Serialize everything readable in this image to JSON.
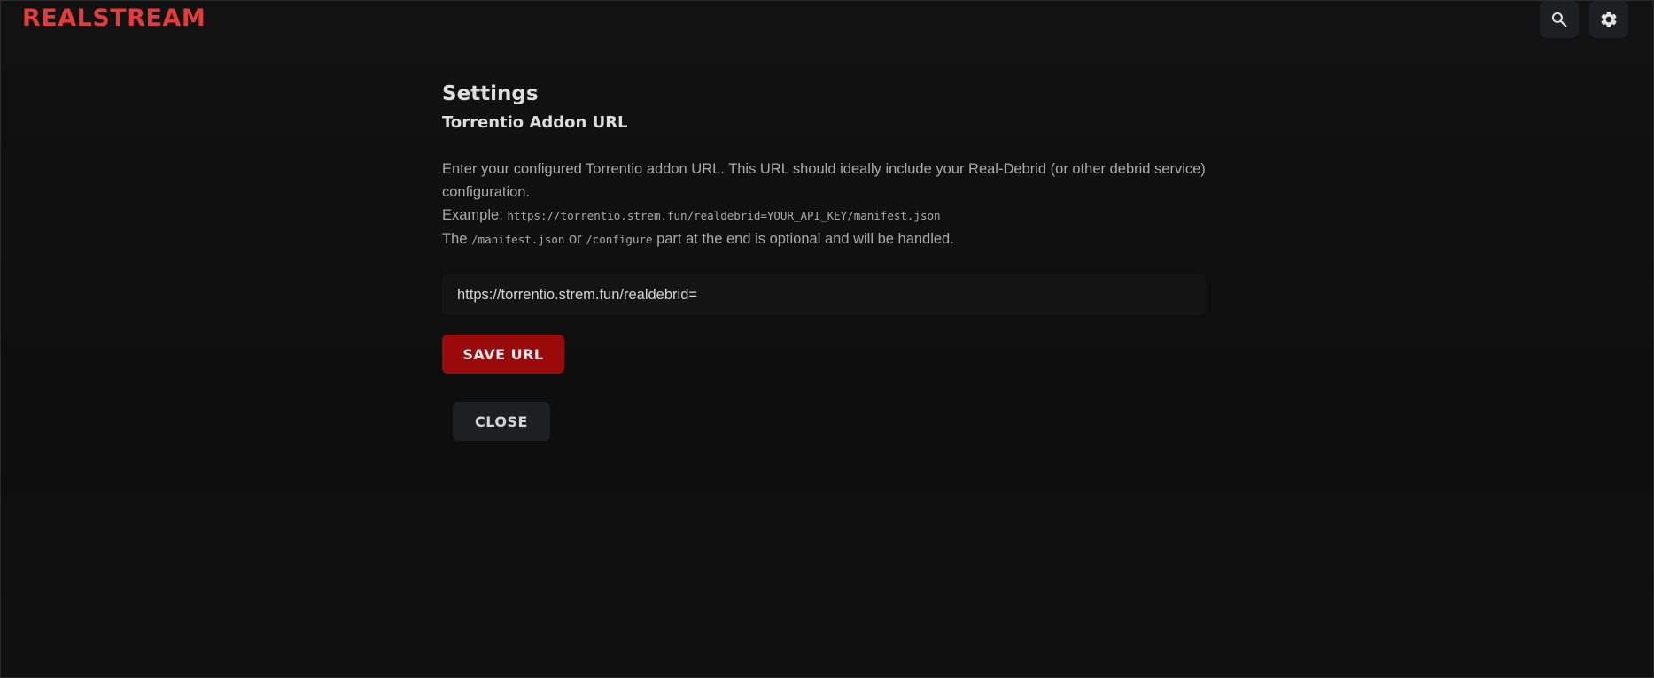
{
  "header": {
    "logo": "REALSTREAM",
    "search_icon": "search-icon",
    "settings_icon": "gear-icon"
  },
  "settings": {
    "title": "Settings",
    "section_title": "Torrentio Addon URL",
    "description_line1": "Enter your configured Torrentio addon URL. This URL should ideally include your Real-Debrid (or other debrid service) configuration.",
    "example_label": "Example: ",
    "example_url": "https://torrentio.strem.fun/realdebrid=YOUR_API_KEY/manifest.json",
    "note_prefix": "The ",
    "note_code1": "/manifest.json",
    "note_mid": " or ",
    "note_code2": "/configure",
    "note_suffix": " part at the end is optional and will be handled.",
    "input_value": "https://torrentio.strem.fun/realdebrid=",
    "save_label": "SAVE URL",
    "close_label": "CLOSE"
  },
  "colors": {
    "brand": "#e63b3b",
    "primary_button": "#9a0a0a",
    "background": "#0f0f0f"
  }
}
